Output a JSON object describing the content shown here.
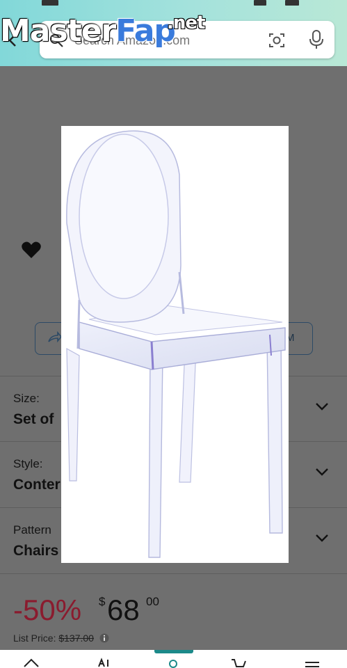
{
  "watermark": {
    "master": "Master",
    "fap": "Fap",
    "net": ".net"
  },
  "search": {
    "placeholder": "Search Amazon.com"
  },
  "buttons": {
    "ar_label": "M"
  },
  "options": [
    {
      "label": "Size:",
      "value": "Set of"
    },
    {
      "label": "Style:",
      "value": "Conter"
    },
    {
      "label": "Pattern",
      "value": "Chairs"
    }
  ],
  "price": {
    "discount": "-50%",
    "symbol": "$",
    "whole": "68",
    "fraction": "00",
    "list_label": "List Price:",
    "list_value": "$137.00"
  },
  "icons": [
    "back-icon",
    "search-icon",
    "camera-icon",
    "mic-icon",
    "heart-icon",
    "share-icon",
    "chevron-down-icon",
    "info-icon",
    "home-icon",
    "ai-icon",
    "profile-icon",
    "cart-icon",
    "menu-icon"
  ]
}
